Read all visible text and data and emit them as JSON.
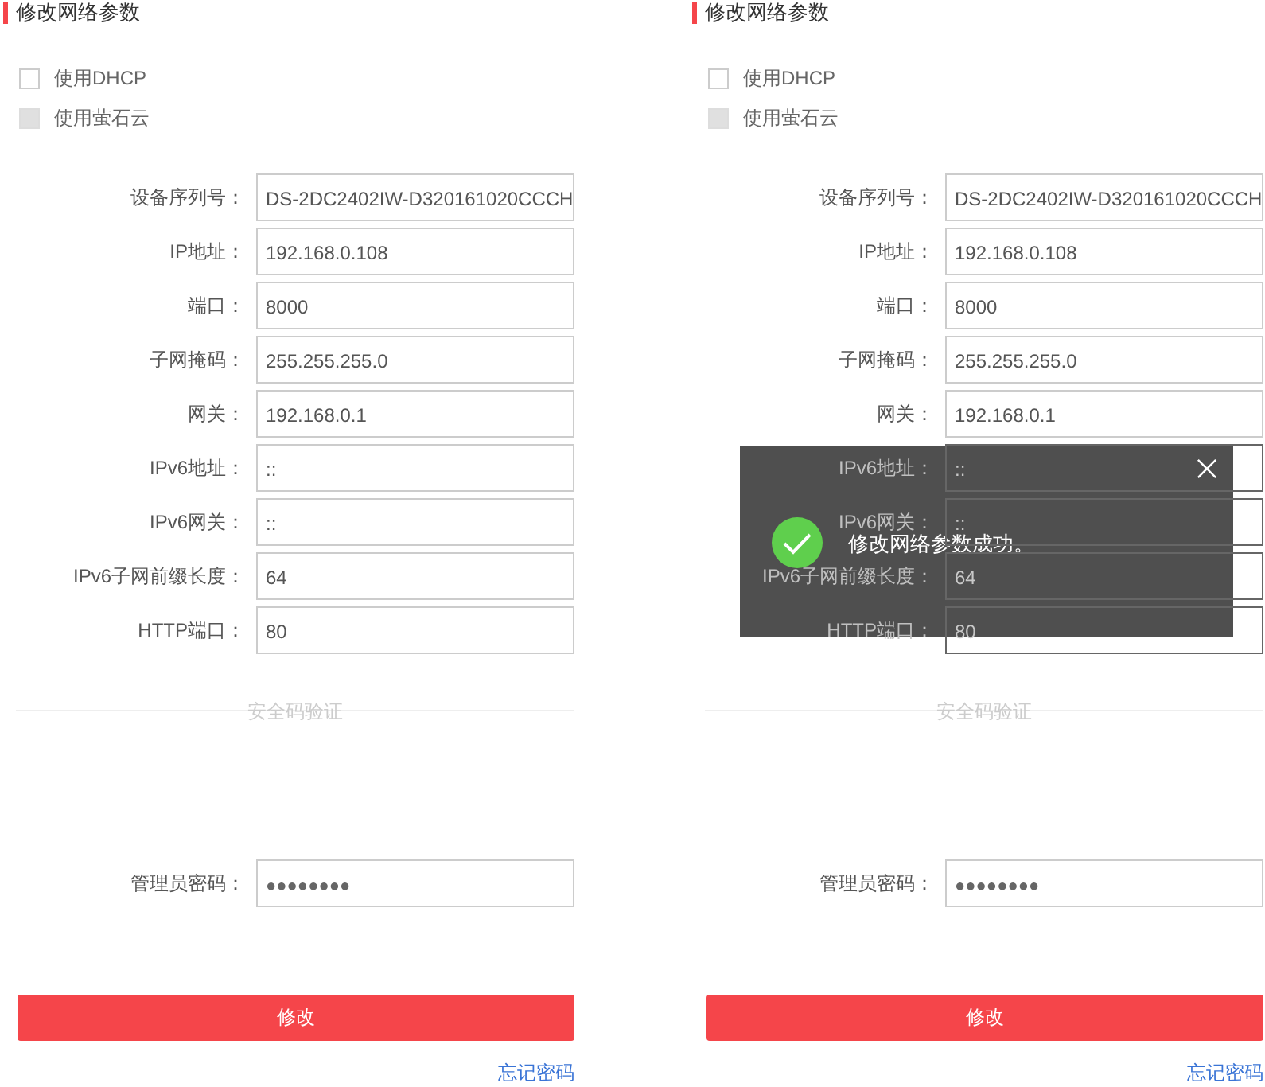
{
  "panels": [
    {
      "title": "修改网络参数",
      "options": [
        {
          "label": "使用DHCP",
          "checked": false,
          "disabled": false
        },
        {
          "label": "使用萤石云",
          "checked": false,
          "disabled": true
        }
      ],
      "fields": [
        {
          "label": "设备序列号：",
          "value": "DS-2DC2402IW-D320161020CCCH"
        },
        {
          "label": "IP地址：",
          "value": "192.168.0.108"
        },
        {
          "label": "端口：",
          "value": "8000"
        },
        {
          "label": "子网掩码：",
          "value": "255.255.255.0"
        },
        {
          "label": "网关：",
          "value": "192.168.0.1"
        },
        {
          "label": "IPv6地址：",
          "value": "::"
        },
        {
          "label": "IPv6网关：",
          "value": "::"
        },
        {
          "label": "IPv6子网前缀长度：",
          "value": "64"
        },
        {
          "label": "HTTP端口：",
          "value": "80"
        }
      ],
      "divider_label": "安全码验证",
      "password": {
        "label": "管理员密码：",
        "value": "●●●●●●●●"
      },
      "submit": "修改",
      "forgot_link": "忘记密码"
    },
    {
      "title": "修改网络参数",
      "options": [
        {
          "label": "使用DHCP",
          "checked": false,
          "disabled": false
        },
        {
          "label": "使用萤石云",
          "checked": false,
          "disabled": true
        }
      ],
      "fields": [
        {
          "label": "设备序列号：",
          "value": "DS-2DC2402IW-D320161020CCCH"
        },
        {
          "label": "IP地址：",
          "value": "192.168.0.108"
        },
        {
          "label": "端口：",
          "value": "8000"
        },
        {
          "label": "子网掩码：",
          "value": "255.255.255.0"
        },
        {
          "label": "网关：",
          "value": "192.168.0.1"
        },
        {
          "label": "IPv6地址：",
          "value": "::"
        },
        {
          "label": "IPv6网关：",
          "value": "::"
        },
        {
          "label": "IPv6子网前缀长度：",
          "value": "64"
        },
        {
          "label": "HTTP端口：",
          "value": "80"
        }
      ],
      "divider_label": "安全码验证",
      "password": {
        "label": "管理员密码：",
        "value": "●●●●●●●●"
      },
      "submit": "修改",
      "forgot_link": "忘记密码",
      "toast": {
        "message": "修改网络参数成功。"
      }
    }
  ]
}
